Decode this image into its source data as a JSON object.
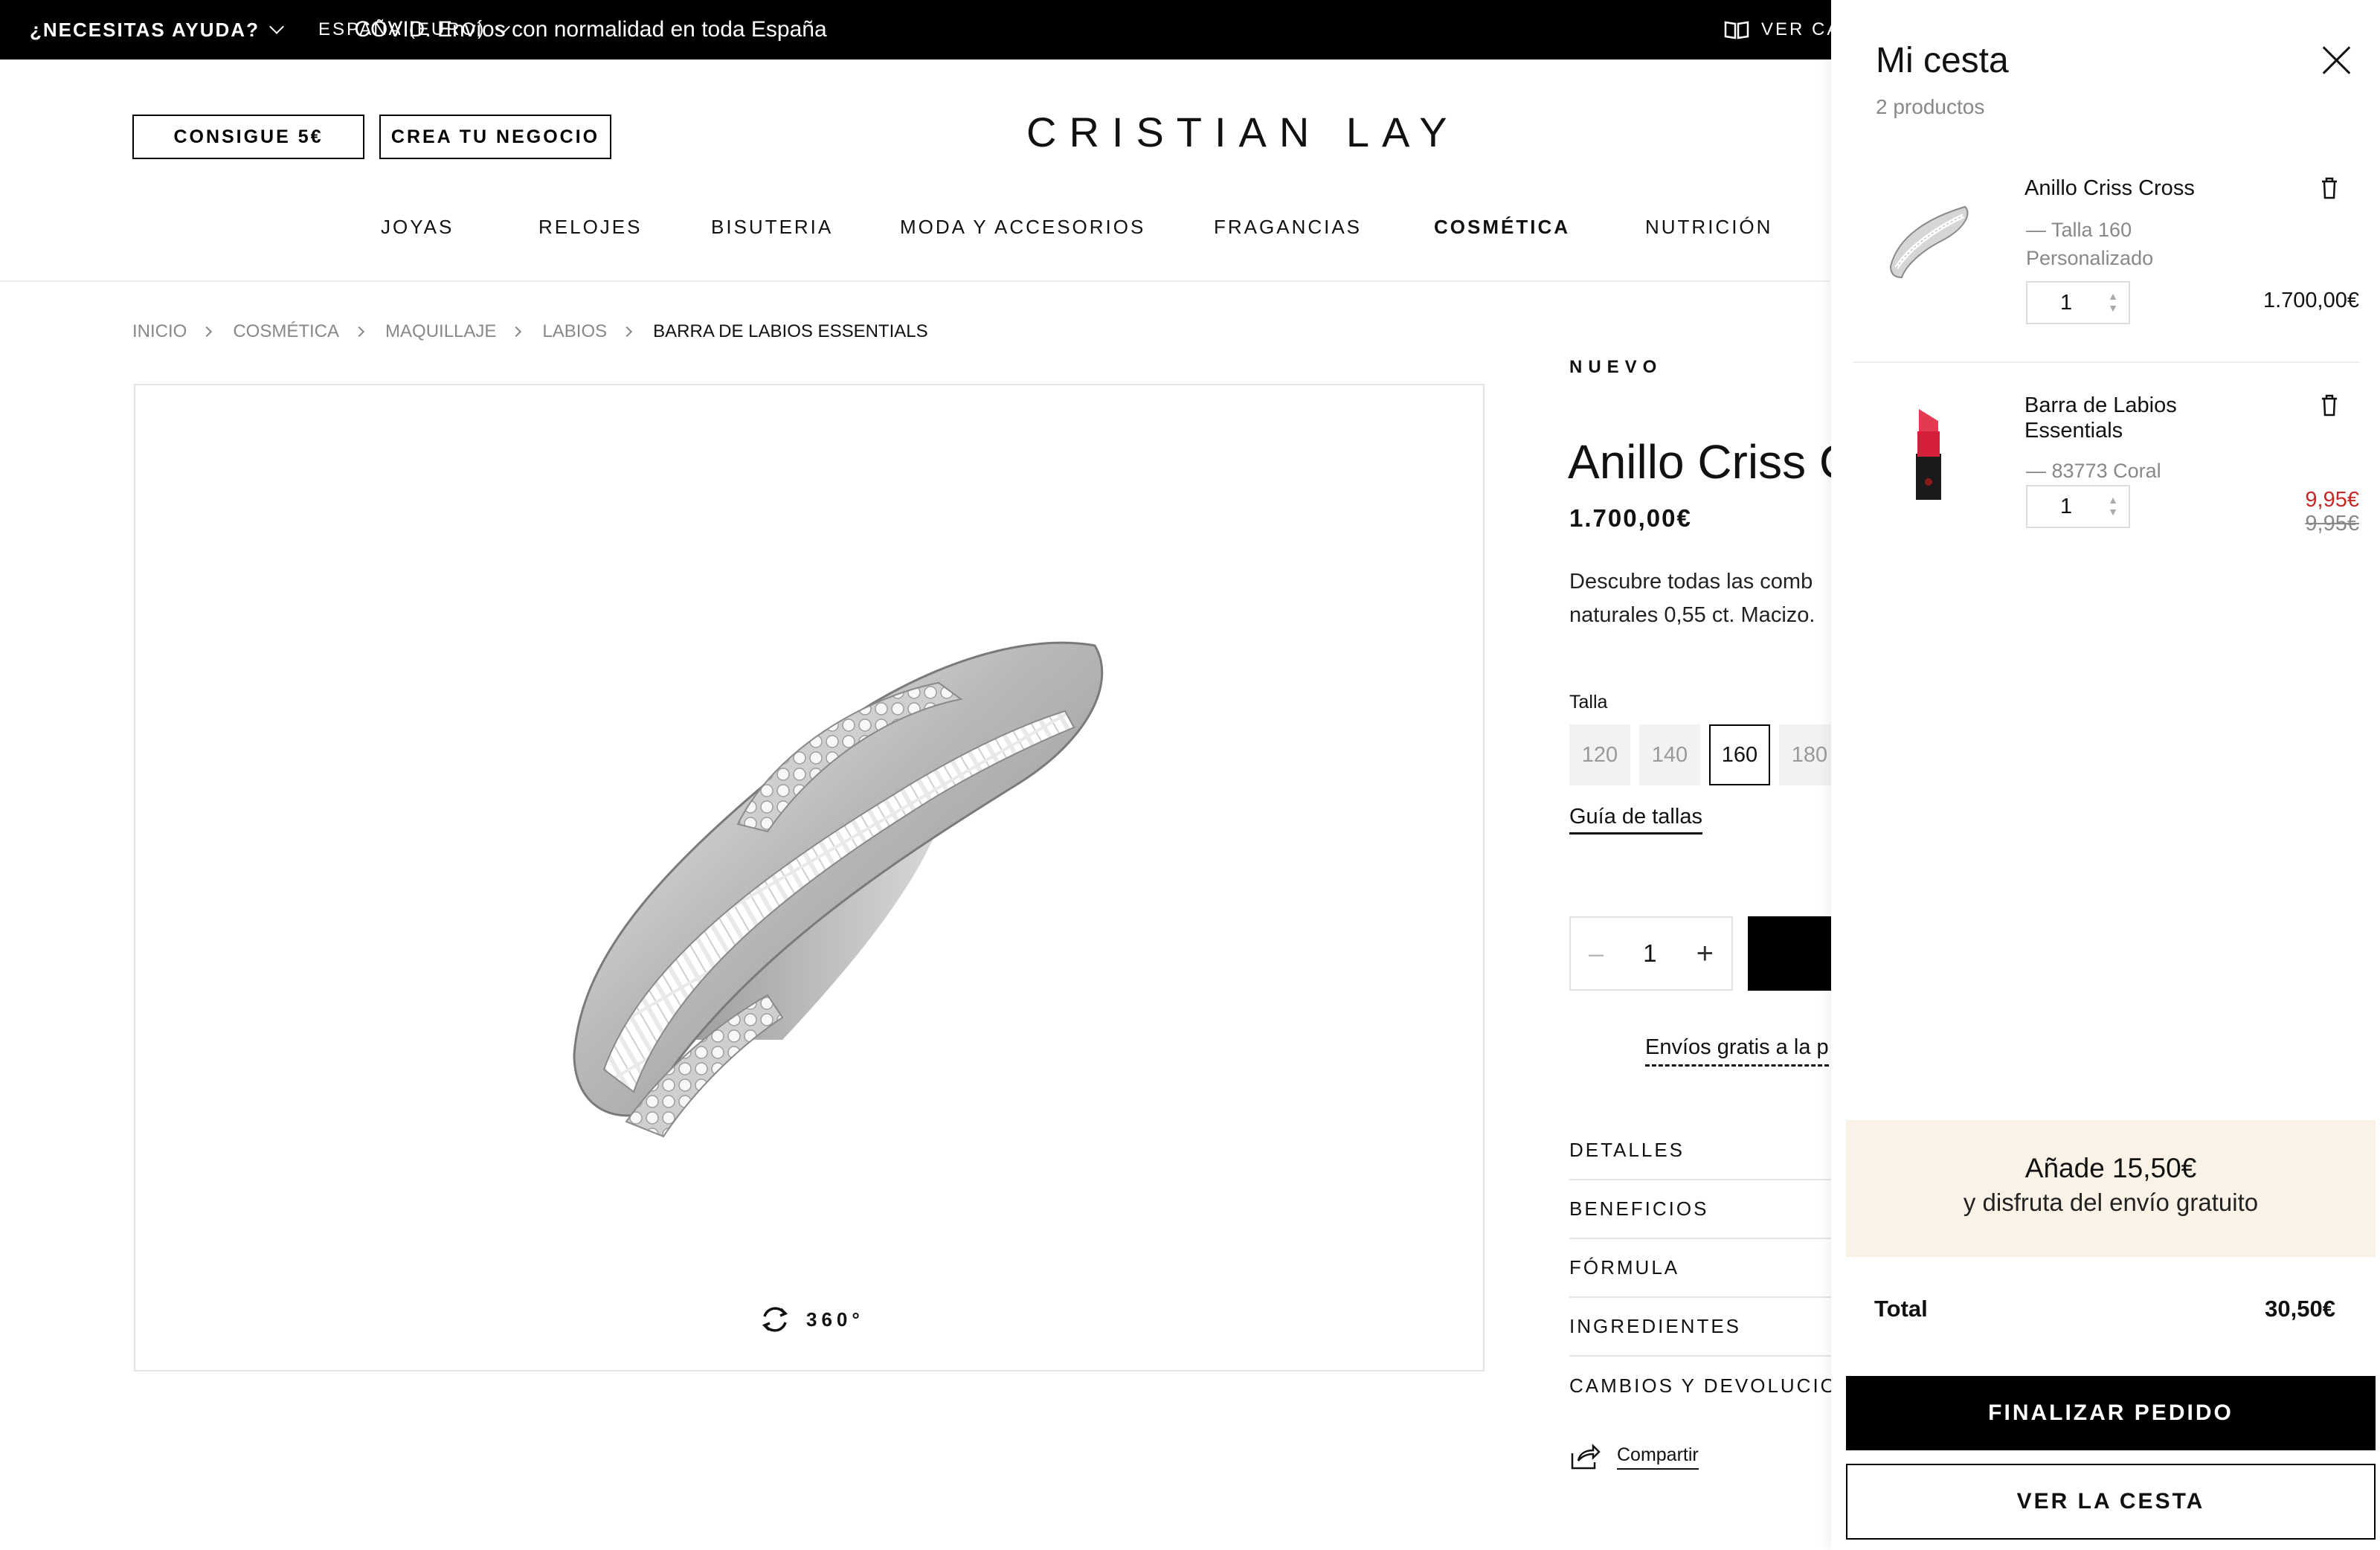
{
  "topbar": {
    "help_label": "¿NECESITAS AYUDA?",
    "country_label": "ESPAÑA (EURO)",
    "announcement": "COVID. Envíos con normalidad en toda España",
    "catalog_label": "VER CA"
  },
  "header": {
    "promo_button": "CONSIGUE 5€",
    "business_button": "CREA TU NEGOCIO",
    "logo": "CRISTIAN LAY"
  },
  "nav": {
    "items": [
      "JOYAS",
      "RELOJES",
      "BISUTERIA",
      "MODA Y ACCESORIOS",
      "FRAGANCIAS",
      "COSMÉTICA",
      "NUTRICIÓN"
    ],
    "active": "COSMÉTICA"
  },
  "breadcrumb": [
    "INICIO",
    "COSMÉTICA",
    "MAQUILLAJE",
    "LABIOS",
    "BARRA DE LABIOS ESSENTIALS"
  ],
  "gallery": {
    "view360_label": "360°"
  },
  "product": {
    "badge": "NUEVO",
    "title": "Anillo Criss C",
    "price": "1.700,00€",
    "description_line1": "Descubre todas las comb",
    "description_line2": "naturales 0,55 ct. Macizo. ",
    "size_label": "Talla",
    "sizes": [
      "120",
      "140",
      "160",
      "180"
    ],
    "selected_size": "160",
    "size_guide": "Guía de tallas",
    "quantity": "1",
    "free_shipping": "Envíos gratis a la p",
    "accordion": [
      "DETALLES",
      "BENEFICIOS",
      "FÓRMULA",
      "INGREDIENTES",
      "CAMBIOS Y DEVOLUCION"
    ],
    "share_label": "Compartir"
  },
  "cart": {
    "title": "Mi cesta",
    "count": "2 productos",
    "items": [
      {
        "name": "Anillo Criss Cross",
        "variant": "— Talla 160",
        "extra": "Personalizado",
        "quantity": "1",
        "price": "1.700,00€"
      },
      {
        "name": "Barra de Labios Essentials",
        "variant": "— 83773 Coral",
        "quantity": "1",
        "sale_price": "9,95€",
        "old_price": "9,95€"
      }
    ],
    "banner_line1": "Añade 15,50€",
    "banner_line2": "y disfruta del envío gratuito",
    "total_label": "Total",
    "total_value": "30,50€",
    "checkout_button": "FINALIZAR PEDIDO",
    "view_cart_button": "VER LA CESTA",
    "colors": {
      "sale": "#c62828",
      "banner_bg": "#faf2e6"
    }
  }
}
